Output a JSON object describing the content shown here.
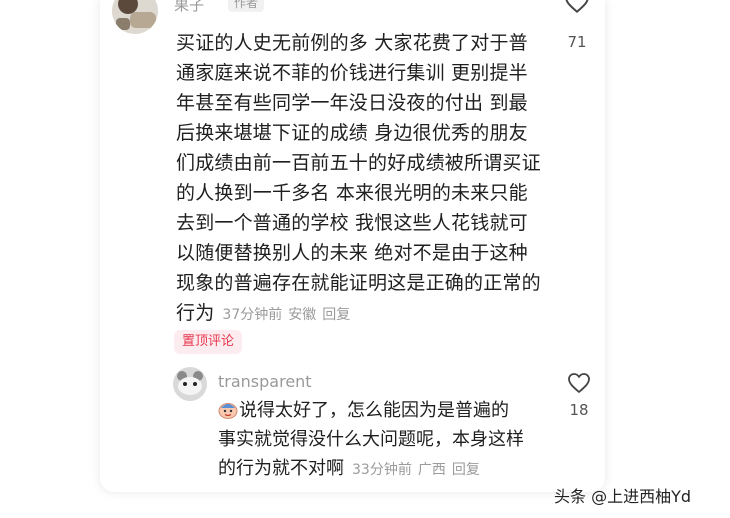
{
  "main_comment": {
    "username": "果子",
    "author_tag": "作者",
    "likes": "71",
    "lines": [
      "买证的人史无前例的多 大家花费了对于普",
      "通家庭来说不菲的价钱进行集训 更别提半",
      "年甚至有些同学一年没日没夜的付出 到最",
      "后换来堪堪下证的成绩 身边很优秀的朋友",
      "们成绩由前一百前五十的好成绩被所谓买证",
      "的人换到一千多名 本来很光明的未来只能",
      "去到一个普通的学校 我恨这些人花钱就可",
      "以随便替换别人的未来 绝对不是由于这种",
      "现象的普遍存在就能证明这是正确的正常的",
      "行为"
    ],
    "time": "37分钟前",
    "location": "安徽",
    "reply_label": "回复",
    "pin_badge": "置顶评论"
  },
  "reply": {
    "username": "transparent",
    "likes": "18",
    "lines": [
      "说得太好了，怎么能因为是普遍的",
      "事实就觉得没什么大问题呢，本身这样",
      "的行为就不对啊"
    ],
    "time": "33分钟前",
    "location": "广西",
    "reply_label": "回复"
  },
  "watermark": "头条 @上进西柚Yd",
  "icons": {
    "like": "heart-outline-icon",
    "emoji": "emoji-icon"
  },
  "colors": {
    "text": "#1f1f1f",
    "meta": "#9b9b9b",
    "pin": "#e8384f",
    "pin_bg": "#fdecef"
  }
}
